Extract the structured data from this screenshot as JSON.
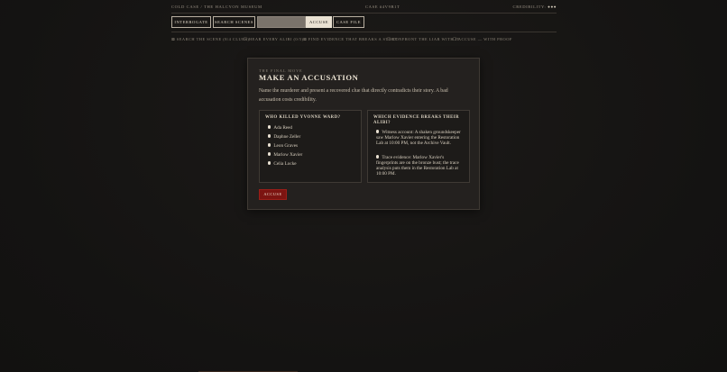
{
  "header": {
    "breadcrumb": "Cold Case / The Halcyon Museum",
    "case_id": "Case #4V9B1T",
    "credibility_label": "Credibility:",
    "credibility_dots": "●●●"
  },
  "tabs": [
    {
      "label": "Interrogate",
      "state": "normal"
    },
    {
      "label": "Search Scenes",
      "state": "normal"
    },
    {
      "label": "",
      "state": "disabled"
    },
    {
      "label": "Accuse",
      "state": "active"
    },
    {
      "label": "Case File",
      "state": "normal"
    }
  ],
  "progress": [
    "⊠ Search the scene (8/4 clues)",
    "☐ Hear every alibi (0/5)",
    "⊠ Find evidence that breaks a story",
    "☐ Confront the liar with it",
    "☐ Accuse — with proof"
  ],
  "accusation": {
    "eyebrow": "The Final Move",
    "title": "Make an Accusation",
    "description": "Name the murderer and present a recovered clue that directly contradicts their story. A bad accusation costs credibility.",
    "suspects_title": "Who killed Yvonne Ward?",
    "suspects": [
      "Ada Reed",
      "Daphne Zeller",
      "Leon Graves",
      "Marlow Xavier",
      "Celia Locke"
    ],
    "evidence_title": "Which evidence breaks their alibi?",
    "evidence": [
      "Witness account: A shaken groundskeeper saw Marlow Xavier entering the Restoration Lab at 10:00 PM, not the Archive Vault.",
      "Trace evidence: Marlow Xavier's fingerprints are on the bronze bust; the trace analysis puts them in the Restoration Lab at 10:00 PM."
    ],
    "accuse_button": "Accuse"
  }
}
